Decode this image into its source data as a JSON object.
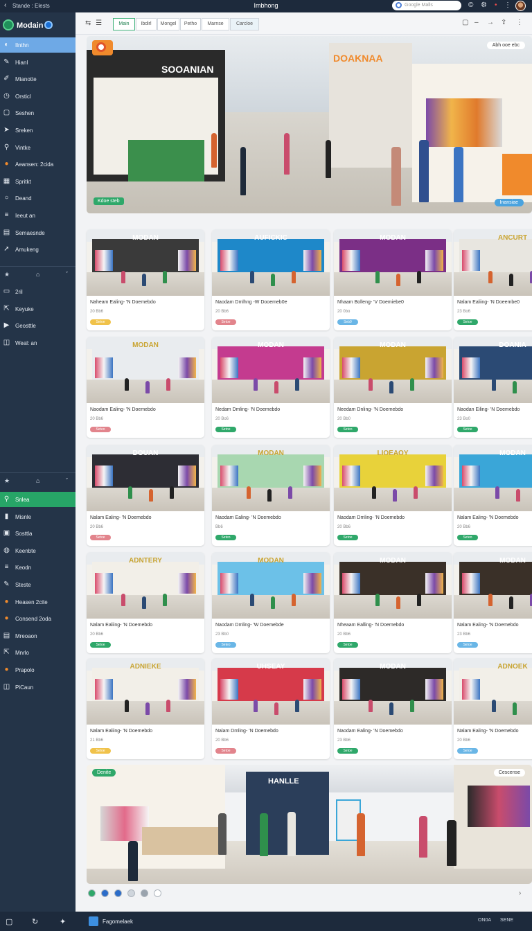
{
  "topbar": {
    "breadcrumb": "Stande : Elests",
    "title": "Imbhong",
    "search_placeholder": "Google Malls",
    "icons": [
      "back-arrow-icon",
      "search-icon",
      "copyright-icon",
      "settings-icon",
      "notification-dot-icon",
      "more-icon",
      "avatar"
    ]
  },
  "sidebar": {
    "brand": "Modain",
    "group1": [
      {
        "label": "Ilnthn",
        "icon": "palette-icon",
        "active": true
      },
      {
        "label": "Hianl",
        "icon": "pin-icon"
      },
      {
        "label": "Mianotte",
        "icon": "pencil-icon"
      },
      {
        "label": "Orsticl",
        "icon": "clock-icon"
      },
      {
        "label": "Seshen",
        "icon": "square-icon"
      },
      {
        "label": "Sreken",
        "icon": "send-icon"
      },
      {
        "label": "Vintke",
        "icon": "search-icon"
      },
      {
        "label": "Aeansen: 2cida",
        "icon": "orange-ball-icon"
      },
      {
        "label": "Spritkt",
        "icon": "grid-icon"
      },
      {
        "label": "Deand",
        "icon": "circle-icon"
      },
      {
        "label": "Ieeut an",
        "icon": "list-icon"
      },
      {
        "label": "Semaesnde",
        "icon": "doc-icon"
      },
      {
        "label": "Amukeng",
        "icon": "arrow-icon"
      }
    ],
    "group2": [
      {
        "label": "2ril",
        "icon": "folder-icon"
      },
      {
        "label": "Keyuke",
        "icon": "share-icon"
      },
      {
        "label": "Geosttle",
        "icon": "play-icon"
      },
      {
        "label": "Weal: an",
        "icon": "window-icon"
      }
    ],
    "group3": [
      {
        "label": "Snlea",
        "icon": "search-icon",
        "active": true
      },
      {
        "label": "Misnle",
        "icon": "bar-icon"
      },
      {
        "label": "Sosttla",
        "icon": "box-icon"
      },
      {
        "label": "Keenbte",
        "icon": "globe-icon"
      },
      {
        "label": "Keodn",
        "icon": "list-icon"
      },
      {
        "label": "Steste",
        "icon": "pin-icon"
      },
      {
        "label": "Heasen 2cite",
        "icon": "orange-ball-icon"
      },
      {
        "label": "Consend 2oda",
        "icon": "orange-ball-icon"
      },
      {
        "label": "Mreoaon",
        "icon": "doc-icon"
      },
      {
        "label": "Mnrlo",
        "icon": "share-icon"
      },
      {
        "label": "Prapolo",
        "icon": "orange-ball-icon"
      },
      {
        "label": "PiCaun",
        "icon": "window-icon"
      }
    ]
  },
  "toolbar": {
    "tabs": [
      "Main",
      "Ibdirl",
      "Mongel",
      "Petho",
      "Marnse",
      "Carcloe"
    ],
    "active_tab": 0
  },
  "hero": {
    "sign_left": "SOOANIAN",
    "sign_right": "DOAKNAA",
    "pill_top_right": "Abh ooe ebc",
    "pill_bottom_left": "Kdoe steb",
    "pill_bottom_right": "Inansiae"
  },
  "cards": [
    {
      "sign": "MODAN",
      "title": "Naheam Ealing- 'N Doemebdo",
      "sub": "20 Bb6",
      "tag": "Setoe",
      "tag_color": "#f0c24a",
      "theme": "#3a3a3a"
    },
    {
      "sign": "AUFICKIC",
      "title": "Naodam Dmlhng -W Dooemeb0e",
      "sub": "20 Bb6",
      "tag": "Setoe",
      "tag_color": "#e2848c",
      "theme": "#1e88c9"
    },
    {
      "sign": "MODAN",
      "title": "Nhaam Bolleng- 'V Doemiebe0",
      "sub": "20 0bo",
      "tag": "Seb9",
      "tag_color": "#6ab6e6",
      "theme": "#7b2f86"
    },
    {
      "sign": "ANCURT",
      "title": "Nalam Ealiing- 'N Doeembe0",
      "sub": "23 Bo6",
      "tag": "Setoe",
      "tag_color": "#2fa86a",
      "theme": "#e8e6e0"
    },
    {
      "sign": "MODAN",
      "title": "Naodam Ealing- 'N Doemebdo",
      "sub": "20 Bb6",
      "tag": "Seteo",
      "tag_color": "#e2848c",
      "theme": "#e9ecef"
    },
    {
      "sign": "MODAN",
      "title": "Nedam Dmling- 'N Doemebdo",
      "sub": "20 Bo6",
      "tag": "Setoe",
      "tag_color": "#2fa86a",
      "theme": "#c43b8f"
    },
    {
      "sign": "MODAN",
      "title": "Needam Dnling- 'N Doemebdo",
      "sub": "20 Bb0",
      "tag": "Seteo",
      "tag_color": "#2fa86a",
      "theme": "#c9a431"
    },
    {
      "sign": "DOANIA",
      "title": "Naodan Eiling- 'N Doemebdo",
      "sub": "23 Bo0",
      "tag": "Setoe",
      "tag_color": "#2fa86a",
      "theme": "#2b4a74"
    },
    {
      "sign": "DOUAN",
      "title": "Nalam Ealing- 'N Doemebdo",
      "sub": "20 Bb6",
      "tag": "Setoe",
      "tag_color": "#e2848c",
      "theme": "#2d2d34"
    },
    {
      "sign": "MODAN",
      "title": "Naodam Ealing- 'N Doemebdo",
      "sub": "Bb6",
      "tag": "Seteo",
      "tag_color": "#2fa86a",
      "theme": "#a8d7b0"
    },
    {
      "sign": "LIOEAOY",
      "title": "Naodam Dmling- 'N Doemebdo",
      "sub": "20 Bb6",
      "tag": "Setoe",
      "tag_color": "#2fa86a",
      "theme": "#e8d23a"
    },
    {
      "sign": "MODAN",
      "title": "Nalam Ealing- 'N Doemebdo",
      "sub": "20 Bb6",
      "tag": "Seteo",
      "tag_color": "#2fa86a",
      "theme": "#3aa6d8"
    },
    {
      "sign": "ADNTERY",
      "title": "Nalam Ealiing- 'N Doemebdo",
      "sub": "20 Bb6",
      "tag": "Setoe",
      "tag_color": "#2fa86a",
      "theme": "#f2efe8"
    },
    {
      "sign": "MODAN",
      "title": "Naodam Dmling- 'W Doemebde",
      "sub": "23 Bb0",
      "tag": "Seteo",
      "tag_color": "#6ab6e6",
      "theme": "#6cc1e8"
    },
    {
      "sign": "MODAN",
      "title": "Nheaam Ealling- 'N Doemebdo",
      "sub": "20 Bb6",
      "tag": "Setoe",
      "tag_color": "#2fa86a",
      "theme": "#3a3028"
    },
    {
      "sign": "MODAN",
      "title": "Nalam Ealing- 'N Doemebdo",
      "sub": "23 Bb6",
      "tag": "Setoe",
      "tag_color": "#6ab6e6",
      "theme": "#3a3028"
    },
    {
      "sign": "ADNIEKE",
      "title": "Nalam Ealiing- 'N Doemebdo",
      "sub": "21 Bb6",
      "tag": "Setoe",
      "tag_color": "#f0c24a",
      "theme": "#f2efe8"
    },
    {
      "sign": "UHSEAY",
      "title": "Nalam Dmling- 'N Doemebdo",
      "sub": "20 Bb6",
      "tag": "Setoe",
      "tag_color": "#e2848c",
      "theme": "#d63a4a"
    },
    {
      "sign": "MODAN",
      "title": "Naodam Ealing- 'N Doemebdo",
      "sub": "23 Bb6",
      "tag": "Setoe",
      "tag_color": "#2fa86a",
      "theme": "#2d2a28"
    },
    {
      "sign": "ADNOEK",
      "title": "Nalam Ealing- 'N Doemebdo",
      "sub": "20 Bb6",
      "tag": "Setoe",
      "tag_color": "#6ab6e6",
      "theme": "#f2efe8"
    }
  ],
  "banner": {
    "pill_left": "Denite",
    "pill_right": "Cescense",
    "sign": "HANLLE"
  },
  "pager": {
    "dots": [
      "#2fa86a",
      "#2b6cc9",
      "#2b6cc9",
      "#cfd5dc",
      "#9aa3ad",
      "#ffffff"
    ],
    "next_icon": "chevron-right-icon"
  },
  "bottombar": {
    "app_name": "Fagomelaek",
    "status": "ON0A",
    "status2": "SENE"
  }
}
